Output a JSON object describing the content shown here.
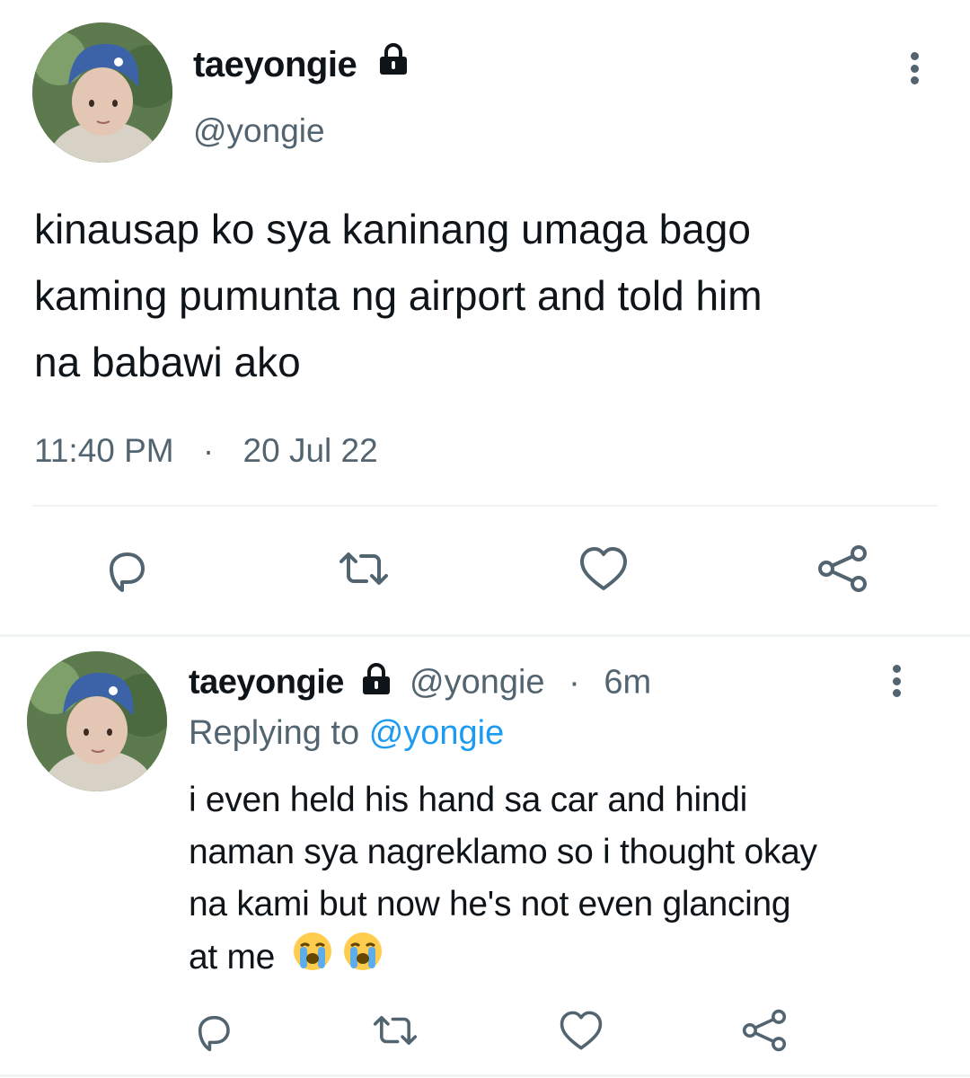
{
  "main_tweet": {
    "display_name": "taeyongie",
    "handle": "@yongie",
    "text_lines": [
      "kinausap ko sya kaninang umaga bago",
      "kaming pumunta ng airport and told him",
      "na babawi ako"
    ],
    "time": "11:40 PM",
    "separator": "·",
    "date": "20 Jul 22",
    "avatar_icon": "avatar-photo",
    "menu_icon": "more-vertical-icon",
    "lock_icon": "lock-icon",
    "actions": [
      "reply-icon",
      "retweet-icon",
      "like-icon",
      "share-icon"
    ]
  },
  "reply_tweet": {
    "display_name": "taeyongie",
    "handle": "@yongie",
    "separator": "·",
    "age": "6m",
    "replying_prefix": "Replying to",
    "replying_handle": "@yongie",
    "text_lines": [
      "i even held his hand sa car and hindi",
      "naman sya nagreklamo so i thought okay",
      "na kami but now he's not even glancing",
      "at me"
    ],
    "emojis": [
      "loudly-crying-face",
      "loudly-crying-face"
    ],
    "actions": [
      "reply-icon",
      "retweet-icon",
      "like-icon",
      "share-icon"
    ]
  },
  "colors": {
    "text": "#0f1419",
    "muted": "#536471",
    "link": "#1d9bf0",
    "divider": "#eff3f4"
  }
}
